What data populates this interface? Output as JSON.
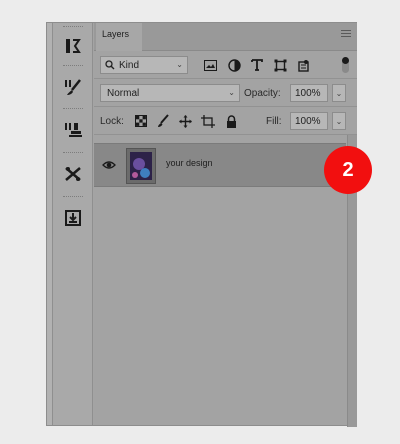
{
  "panel": {
    "tab_label": "Layers",
    "filter": {
      "value": "Kind"
    },
    "filter_icons": [
      "image-icon",
      "adjustment-icon",
      "type-icon",
      "shape-icon",
      "smart-object-icon"
    ],
    "blend_mode": "Normal",
    "opacity_label": "Opacity:",
    "opacity_value": "100%",
    "lock_label": "Lock:",
    "lock_icons": [
      "lock-transparent-pixels-icon",
      "lock-image-pixels-icon",
      "lock-position-icon",
      "lock-artboard-icon",
      "lock-all-icon"
    ],
    "fill_label": "Fill:",
    "fill_value": "100%",
    "layers": [
      {
        "name": "your design",
        "visible": true,
        "selected": true
      }
    ]
  },
  "toolbar": {
    "tools": [
      "history-brush-icon",
      "brushes-icon",
      "clone-source-icon",
      "tool-presets-icon",
      "export-icon"
    ]
  },
  "callout": {
    "text": "2",
    "color": "#f20f0f"
  }
}
